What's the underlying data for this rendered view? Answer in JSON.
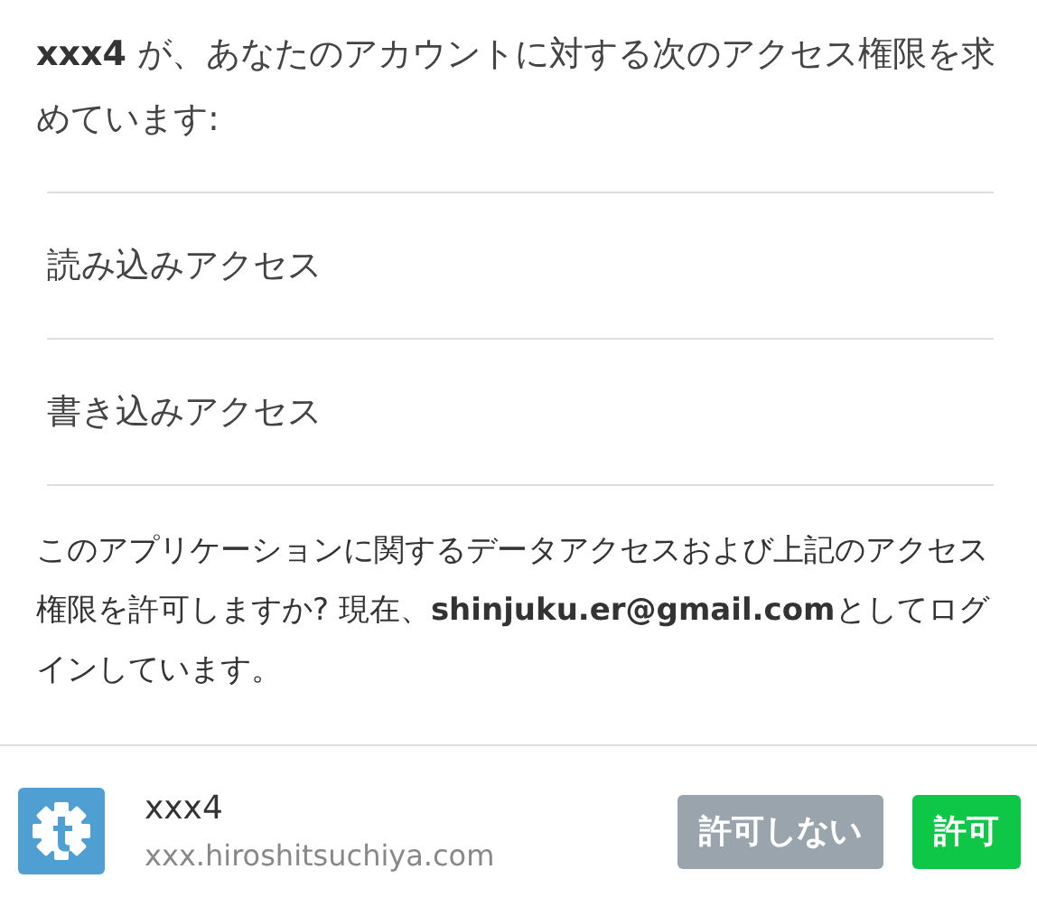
{
  "request": {
    "text": "**xxx4** が、あなたのアカウントに対する次のアクセス権限を求めています:"
  },
  "permissions": [
    {
      "label": "読み込みアクセス"
    },
    {
      "label": "書き込みアクセス"
    }
  ],
  "notice": {
    "text": "このアプリケーションに関するデータアクセスおよび上記のアクセス権限を許可しますか? 現在、**shinjuku.er@gmail.com**としてログインしています。"
  },
  "app": {
    "name": "xxx4",
    "domain": "xxx.hiroshitsuchiya.com"
  },
  "buttons": [
    {
      "label": "許可しない",
      "kind": "deny"
    },
    {
      "label": "許可",
      "kind": "allow"
    }
  ]
}
